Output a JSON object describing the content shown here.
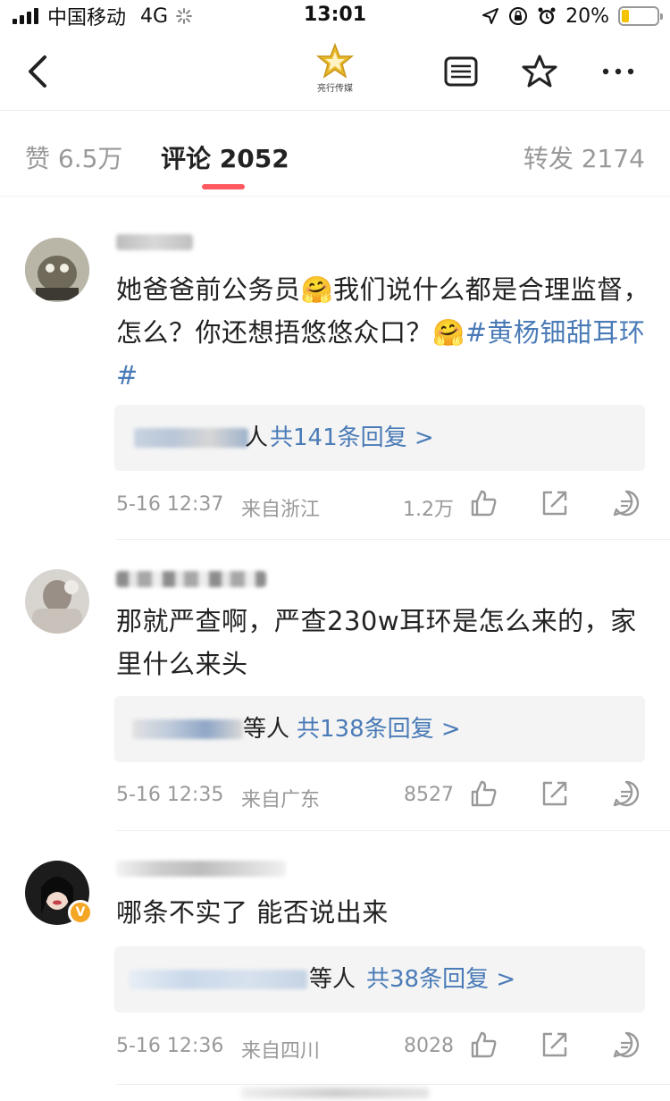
{
  "status_bar": {
    "carrier": "中国移动",
    "network": "4G",
    "time": "13:01",
    "battery": "20%"
  },
  "nav": {
    "logo_text": "亮行传媒"
  },
  "tabs": {
    "likes": "赞 6.5万",
    "comments": "评论 2052",
    "reposts": "转发 2174"
  },
  "colors": {
    "accent": "#ff5a5f",
    "link": "#4a7bb7",
    "muted": "#999999"
  },
  "comments": [
    {
      "text_before": "她爸爸前公务员🤗我们说什么都是合理监督，怎么？你还想捂悠悠众口？🤗",
      "hashtag": "#黄杨钿甜耳环#",
      "reply_suffix": "人",
      "reply_link": "共141条回复 >",
      "time": "5-16 12:37",
      "location": "来自浙江",
      "likes": "1.2万"
    },
    {
      "text_before": "那就严查啊，严查230w耳环是怎么来的，家里什么来头",
      "hashtag": "",
      "reply_suffix": "等人",
      "reply_link": "共138条回复 >",
      "time": "5-16 12:35",
      "location": "来自广东",
      "likes": "8527"
    },
    {
      "text_before": "哪条不实了 能否说出来",
      "hashtag": "",
      "reply_suffix": "等人",
      "reply_link": "共38条回复 >",
      "time": "5-16 12:36",
      "location": "来自四川",
      "likes": "8028"
    }
  ],
  "icons": [
    "back-icon",
    "gold-star-logo",
    "reader-icon",
    "star-icon",
    "more-icon",
    "thumb-up-icon",
    "share-icon",
    "comment-icon"
  ]
}
